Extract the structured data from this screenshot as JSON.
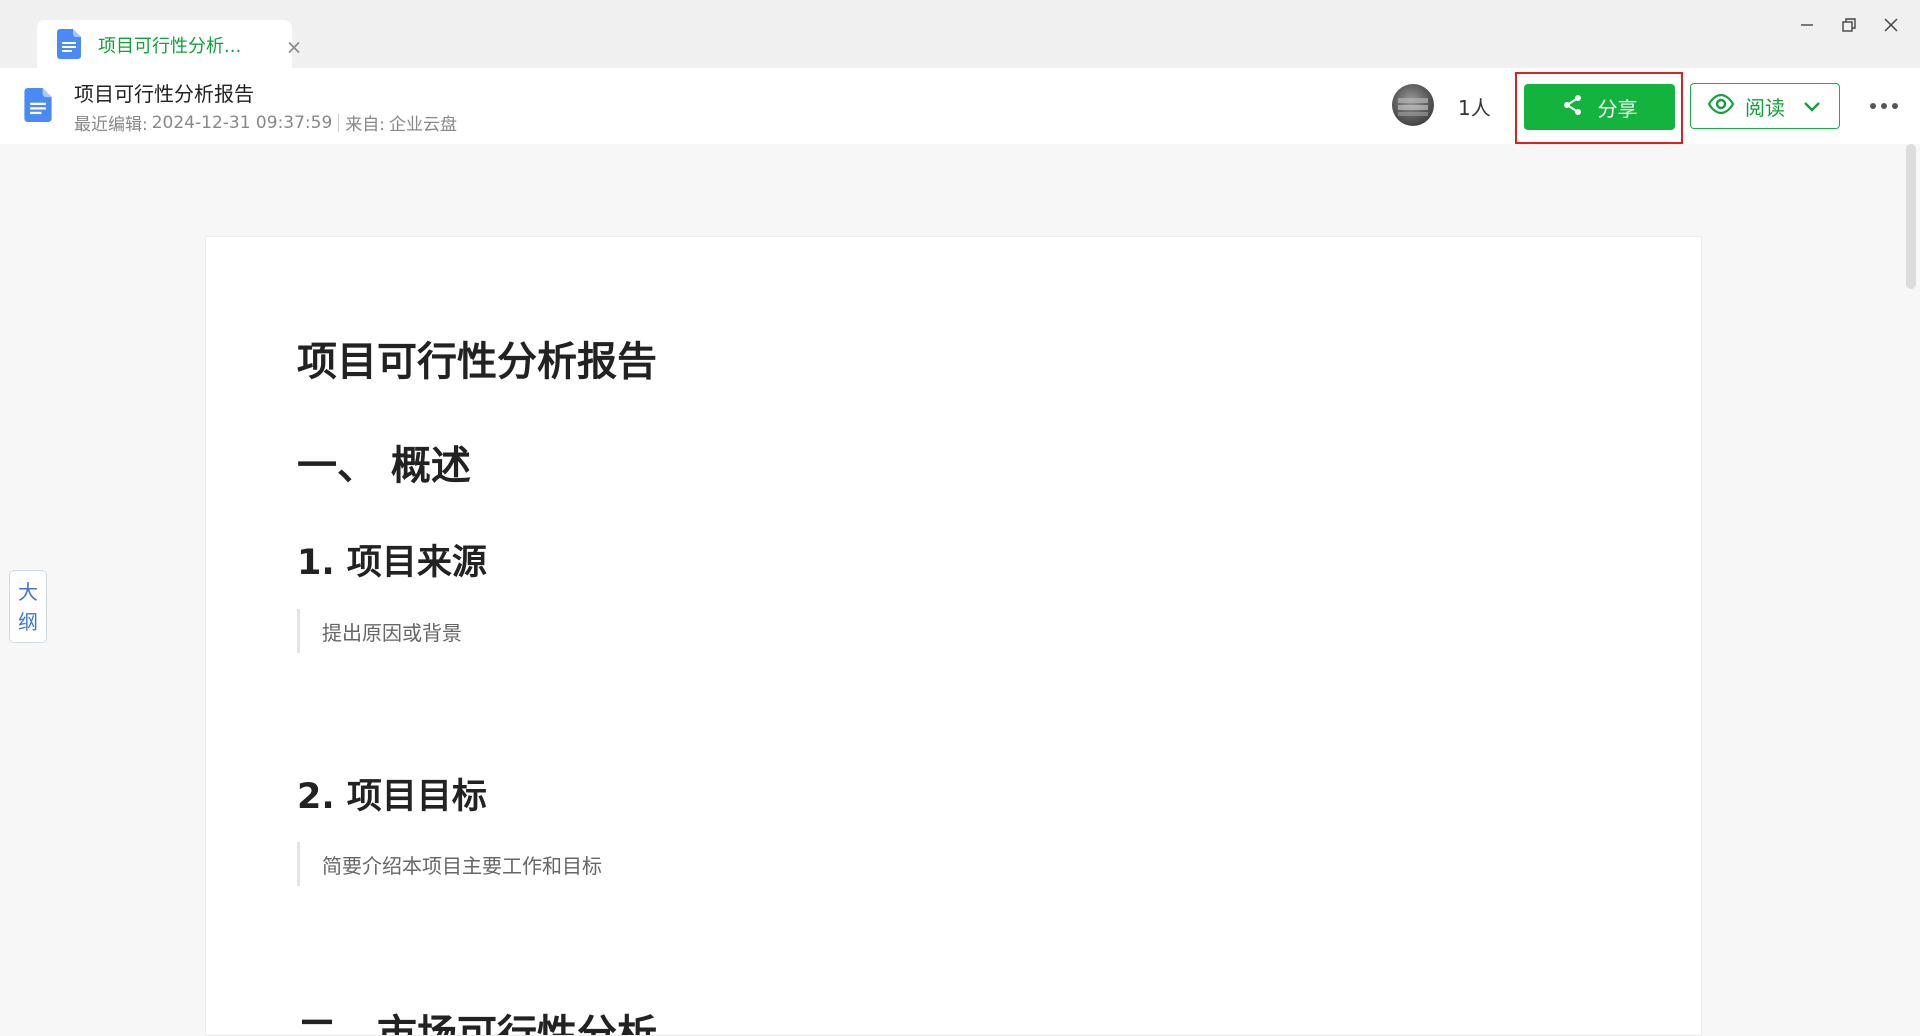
{
  "tab": {
    "title": "项目可行性分析...",
    "close": "×"
  },
  "window_controls": [
    "minimize",
    "restore",
    "close"
  ],
  "header": {
    "title": "项目可行性分析报告",
    "last_edit_label": "最近编辑:",
    "last_edit_time": "2024-12-31 09:37:59",
    "source_label": "来自:",
    "source_value": "企业云盘",
    "collaborators_count": "1人",
    "share_label": "分享",
    "read_label": "阅读"
  },
  "colors": {
    "brand_green": "#13b33e",
    "highlight_red": "#e02020",
    "doc_icon_blue": "#4a8af4",
    "outline_blue": "#3f74d4"
  },
  "outline_tab": {
    "char1": "大",
    "char2": "纲"
  },
  "document": {
    "title": "项目可行性分析报告",
    "section1_heading": "一、 概述",
    "sub1_heading": "1. 项目来源",
    "sub1_text": "提出原因或背景",
    "sub2_heading": "2. 项目目标",
    "sub2_text": "简要介绍本项目主要工作和目标",
    "section2_heading": "二、市场可行性分析"
  }
}
